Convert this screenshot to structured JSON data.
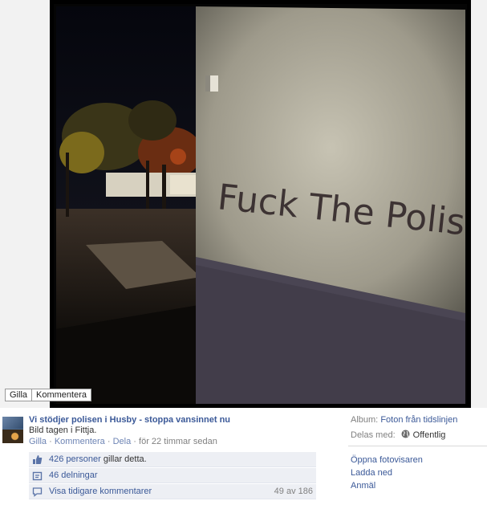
{
  "photo": {
    "graffiti_text": "Fuck The Polis",
    "actions": {
      "like_label": "Gilla",
      "comment_label": "Kommentera"
    }
  },
  "post": {
    "page_name": "Vi stödjer polisen i Husby - stoppa vansinnet nu",
    "caption": "Bild tagen i Fittja.",
    "like_link": "Gilla",
    "comment_link": "Kommentera",
    "share_link": "Dela",
    "separator": "·",
    "timestamp": "för 22 timmar sedan"
  },
  "ufi": {
    "likes_link": "426 personer",
    "likes_suffix": " gillar detta.",
    "shares": "46 delningar",
    "view_earlier": "Visa tidigare kommentarer",
    "comment_count": "49 av 186"
  },
  "sidebar": {
    "album_label": "Album:",
    "album_value": "Foton från tidslinjen",
    "shared_label": "Delas med:",
    "shared_value": "Offentlig",
    "links": [
      "Öppna fotovisaren",
      "Ladda ned",
      "Anmäl"
    ]
  },
  "colors": {
    "link": "#3b5998",
    "ufi_bg": "#edeff4",
    "photo_bg": "#050505"
  },
  "icons": {
    "like": "thumbs-up-icon",
    "share": "share-icon",
    "comment": "comment-icon",
    "privacy": "globe-icon"
  }
}
